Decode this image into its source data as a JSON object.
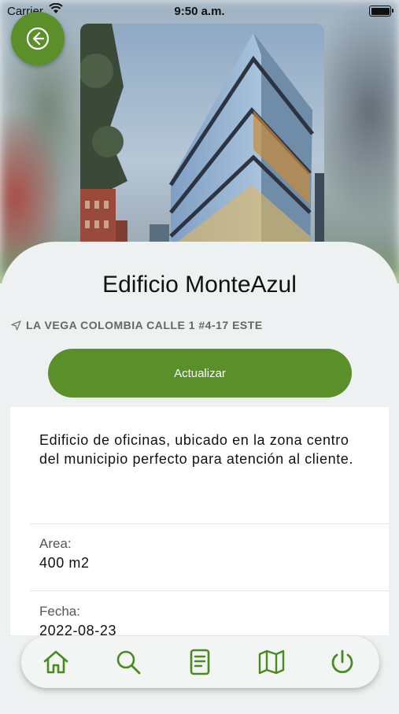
{
  "status_bar": {
    "carrier": "Carrier",
    "time": "9:50 a.m."
  },
  "building": {
    "name": "Edificio MonteAzul",
    "address": "LA VEGA COLOMBIA CALLE 1 #4-17 ESTE",
    "description": "Edificio de oficinas, ubicado en la zona centro del municipio perfecto para atención al cliente.",
    "fields": [
      {
        "label": "Area:",
        "value": "400 m2"
      },
      {
        "label": "Fecha:",
        "value": "2022-08-23"
      }
    ]
  },
  "actions": {
    "update_label": "Actualizar"
  },
  "icons": {
    "back": "back-arrow-circle-icon",
    "location": "navigation-arrow-icon",
    "tabs": [
      "home-icon",
      "search-icon",
      "document-icon",
      "map-icon",
      "power-icon"
    ]
  },
  "colors": {
    "accent": "#5a8f2a",
    "icon_green": "#4a8a1e"
  }
}
